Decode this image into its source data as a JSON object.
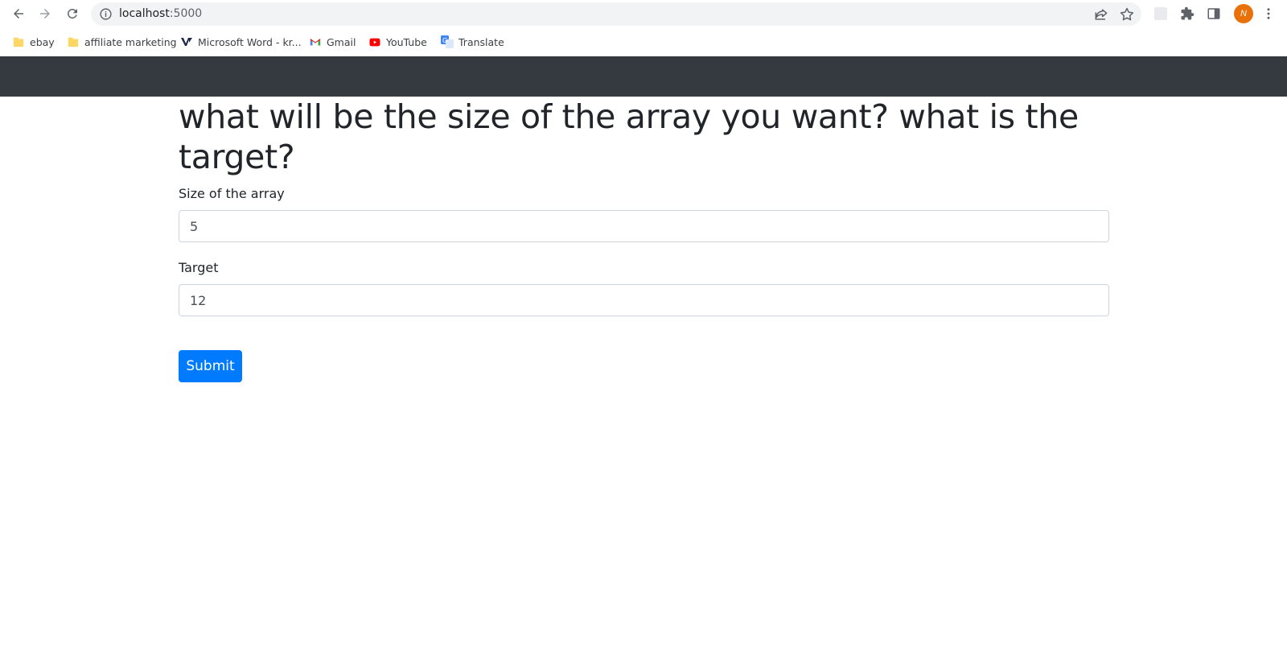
{
  "browser": {
    "url_host": "localhost",
    "url_port": ":5000",
    "profile_initial": "N",
    "bookmarks": [
      {
        "label": "ebay",
        "icon": "folder-icon"
      },
      {
        "label": "affiliate marketing",
        "icon": "folder-icon"
      },
      {
        "label": "Microsoft Word - kr...",
        "icon": "word-icon"
      },
      {
        "label": "Gmail",
        "icon": "gmail-icon"
      },
      {
        "label": "YouTube",
        "icon": "youtube-icon"
      },
      {
        "label": "Translate",
        "icon": "translate-icon"
      }
    ]
  },
  "page": {
    "heading": "what will be the size of the array you want? what is the target?",
    "size_label": "Size of the array",
    "size_value": "5",
    "target_label": "Target",
    "target_value": "12",
    "submit_label": "Submit"
  },
  "colors": {
    "navbar": "#343a40",
    "primary": "#007bff",
    "avatar": "#e8710a"
  }
}
